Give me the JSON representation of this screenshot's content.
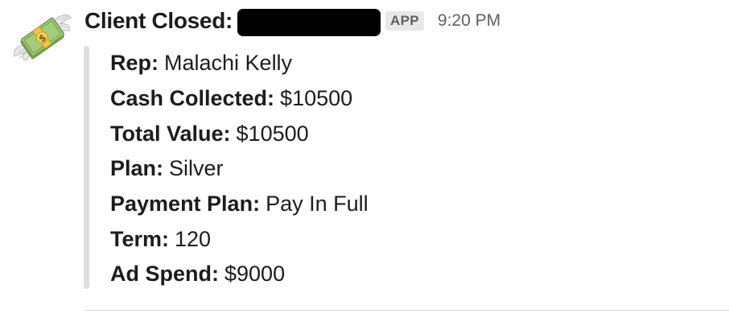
{
  "message": {
    "avatar_icon": "money-with-wings-icon",
    "sender": "Client Closed:",
    "app_badge": "APP",
    "timestamp": "9:20 PM",
    "fields": [
      {
        "label": "Rep:",
        "value": "Malachi Kelly"
      },
      {
        "label": "Cash Collected:",
        "value": "$10500"
      },
      {
        "label": "Total Value:",
        "value": "$10500"
      },
      {
        "label": "Plan:",
        "value": "Silver"
      },
      {
        "label": "Payment Plan:",
        "value": "Pay In Full"
      },
      {
        "label": "Term:",
        "value": "120"
      },
      {
        "label": "Ad Spend:",
        "value": "$9000"
      }
    ]
  },
  "colors": {
    "text": "#1d1c1d",
    "muted": "#616061",
    "badge_bg": "#e8e8e8",
    "attachment_bar": "#dddddd",
    "redaction": "#000000"
  }
}
